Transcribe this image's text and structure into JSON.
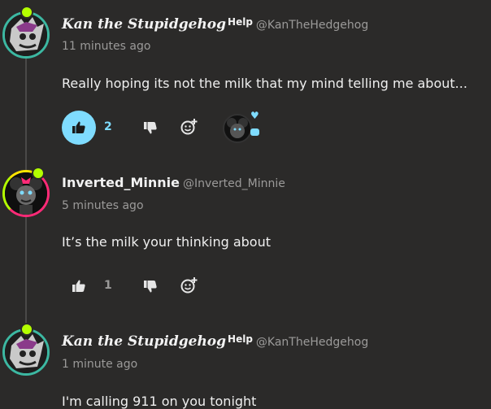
{
  "comments": [
    {
      "name": "Kan the Stupidgehog",
      "help": "Help",
      "handle": "@KanTheHedgehog",
      "time": "11 minutes ago",
      "text": "Really hoping its not the milk that my mind telling me about...",
      "likes": "2",
      "liked": true
    },
    {
      "name": "Inverted_Minnie",
      "handle": "@Inverted_Minnie",
      "time": "5 minutes ago",
      "text": "It’s the milk your thinking about",
      "likes": "1",
      "liked": false
    },
    {
      "name": "Kan the Stupidgehog",
      "help": "Help",
      "handle": "@KanTheHedgehog",
      "time": "1 minute ago",
      "text": "I'm calling 911 on you tonight"
    }
  ],
  "colors": {
    "background": "#2b2a29",
    "accent": "#7fdcff",
    "muted": "#9b9a99"
  }
}
